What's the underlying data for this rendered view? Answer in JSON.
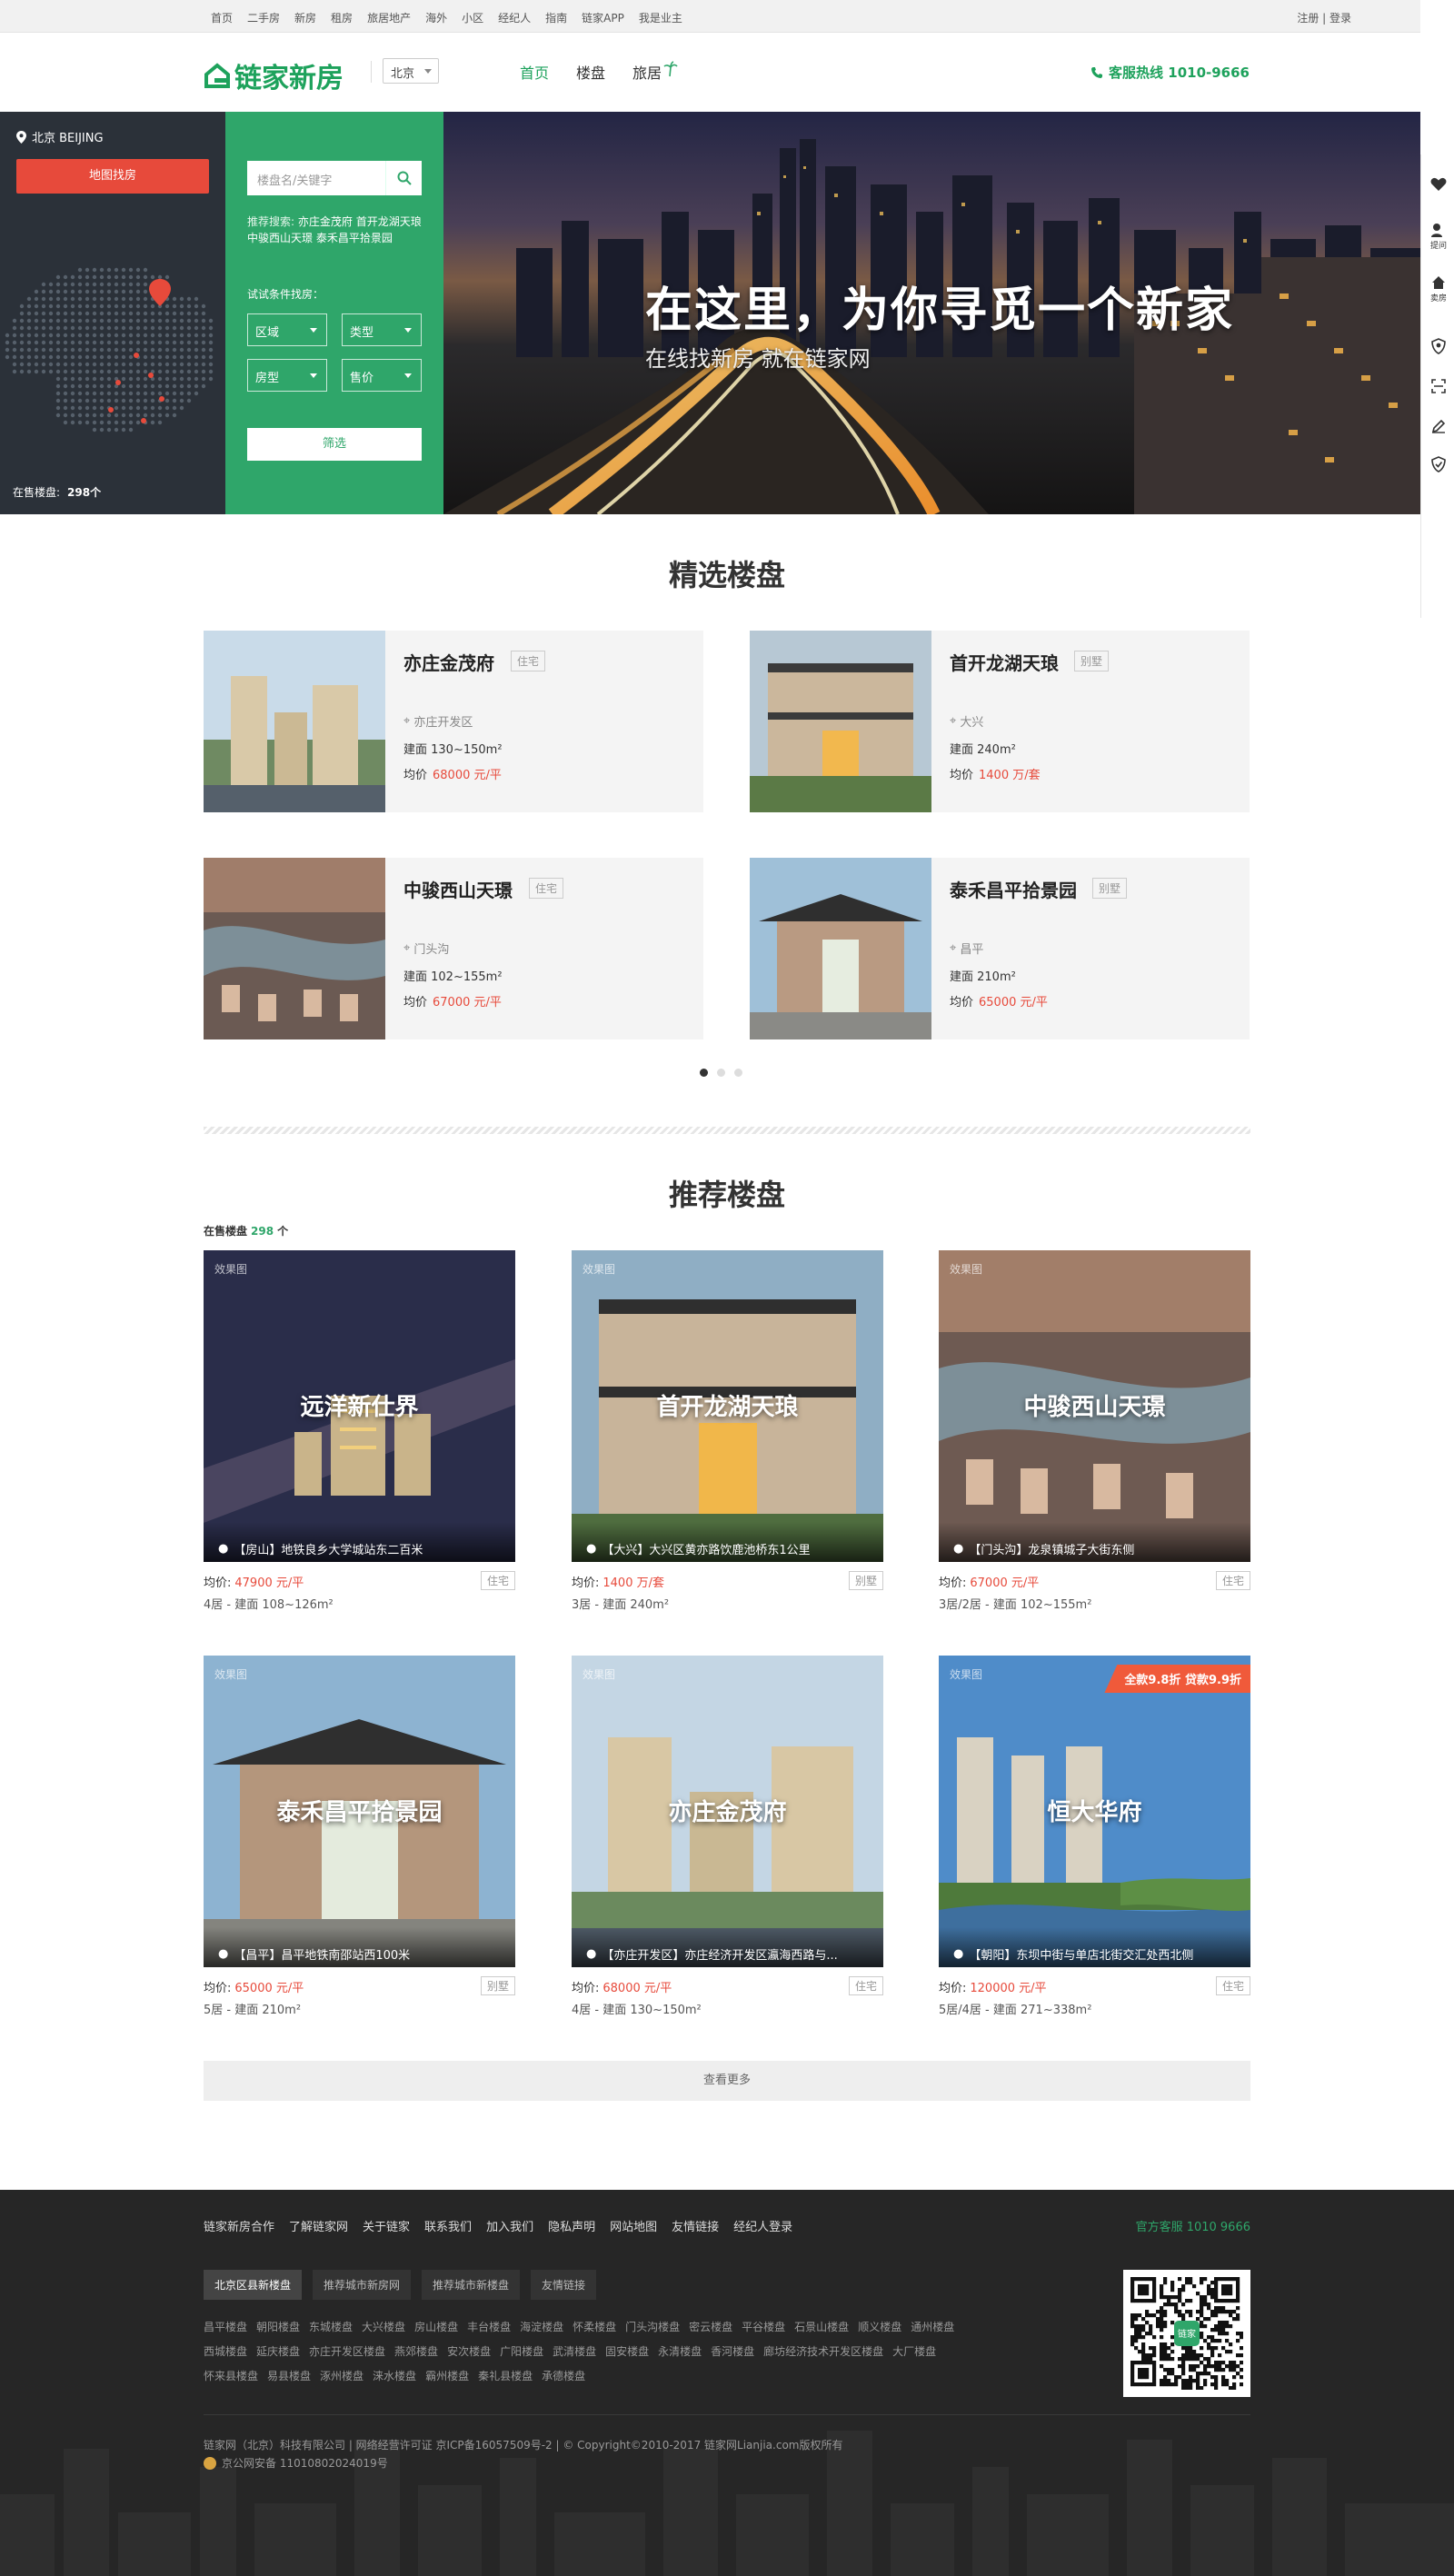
{
  "topnav": {
    "links": [
      "首页",
      "二手房",
      "新房",
      "租房",
      "旅居地产",
      "海外",
      "小区",
      "经纪人",
      "指南",
      "链家APP",
      "我是业主"
    ],
    "auth": "注册 | 登录"
  },
  "header": {
    "logo": "链家新房",
    "city": "北京",
    "menu": [
      "首页",
      "楼盘",
      "旅居"
    ],
    "hotline": "客服热线 1010-9666"
  },
  "mapbox": {
    "city": "北京 BEIJING",
    "map_button": "地图找房",
    "on_sale_label": "在售楼盘:",
    "on_sale_count": "298个"
  },
  "search": {
    "placeholder": "楼盘名/关键字",
    "recommend_label": "推荐搜索:",
    "recommend": "亦庄金茂府 首开龙湖天琅 中骏西山天璟 泰禾昌平拾景园",
    "try_label": "试试条件找房：",
    "filters": [
      "区域",
      "类型",
      "房型",
      "售价"
    ],
    "submit": "筛选"
  },
  "banner": {
    "title": "在这里，为你寻觅一个新家",
    "subtitle": "在线找新房 就在链家网"
  },
  "rightbar": {
    "labels": [
      "提问",
      "卖房"
    ]
  },
  "featured": {
    "title": "精选楼盘",
    "items": [
      {
        "name": "亦庄金茂府",
        "tag": "住宅",
        "loc": "亦庄开发区",
        "area": "建面 130~150m²",
        "price_label": "均价",
        "price": "68000 元/平"
      },
      {
        "name": "首开龙湖天琅",
        "tag": "别墅",
        "loc": "大兴",
        "area": "建面 240m²",
        "price_label": "均价",
        "price": "1400 万/套"
      },
      {
        "name": "中骏西山天璟",
        "tag": "住宅",
        "loc": "门头沟",
        "area": "建面 102~155m²",
        "price_label": "均价",
        "price": "67000 元/平"
      },
      {
        "name": "泰禾昌平拾景园",
        "tag": "别墅",
        "loc": "昌平",
        "area": "建面 210m²",
        "price_label": "均价",
        "price": "65000 元/平"
      }
    ]
  },
  "recommend": {
    "title": "推荐楼盘",
    "on_sale_prefix": "在售楼盘",
    "on_sale_count": "298",
    "on_sale_suffix": "个",
    "items": [
      {
        "label": "效果图",
        "name": "远洋新仕界",
        "addr": "【房山】地铁良乡大学城站东二百米",
        "price_label": "均价:",
        "price": "47900 元/平",
        "layout": "4居 - 建面 108~126m²",
        "tag": "住宅",
        "promo": ""
      },
      {
        "label": "效果图",
        "name": "首开龙湖天琅",
        "addr": "【大兴】大兴区黄亦路饮鹿池桥东1公里",
        "price_label": "均价:",
        "price": "1400 万/套",
        "layout": "3居 - 建面 240m²",
        "tag": "别墅",
        "promo": ""
      },
      {
        "label": "效果图",
        "name": "中骏西山天璟",
        "addr": "【门头沟】龙泉镇城子大街东侧",
        "price_label": "均价:",
        "price": "67000 元/平",
        "layout": "3居/2居 - 建面 102~155m²",
        "tag": "住宅",
        "promo": ""
      },
      {
        "label": "效果图",
        "name": "泰禾昌平拾景园",
        "addr": "【昌平】昌平地铁南邵站西100米",
        "price_label": "均价:",
        "price": "65000 元/平",
        "layout": "5居 - 建面 210m²",
        "tag": "别墅",
        "promo": ""
      },
      {
        "label": "效果图",
        "name": "亦庄金茂府",
        "addr": "【亦庄开发区】亦庄经济开发区瀛海西路与...",
        "price_label": "均价:",
        "price": "68000 元/平",
        "layout": "4居 - 建面 130~150m²",
        "tag": "住宅",
        "promo": ""
      },
      {
        "label": "效果图",
        "name": "恒大华府",
        "addr": "【朝阳】东坝中街与单店北街交汇处西北侧",
        "price_label": "均价:",
        "price": "120000 元/平",
        "layout": "5居/4居 - 建面 271~338m²",
        "tag": "住宅",
        "promo": "全款9.8折 贷款9.9折"
      }
    ],
    "more": "查看更多"
  },
  "footer": {
    "links": [
      "链家新房合作",
      "了解链家网",
      "关于链家",
      "联系我们",
      "加入我们",
      "隐私声明",
      "网站地图",
      "友情链接",
      "经纪人登录"
    ],
    "service": "官方客服 1010 9666",
    "tabs": [
      "北京区县新楼盘",
      "推荐城市新房网",
      "推荐城市新楼盘",
      "友情链接"
    ],
    "cities": [
      "昌平楼盘",
      "朝阳楼盘",
      "东城楼盘",
      "大兴楼盘",
      "房山楼盘",
      "丰台楼盘",
      "海淀楼盘",
      "怀柔楼盘",
      "门头沟楼盘",
      "密云楼盘",
      "平谷楼盘",
      "石景山楼盘",
      "顺义楼盘",
      "通州楼盘",
      "西城楼盘",
      "延庆楼盘",
      "亦庄开发区楼盘",
      "燕郊楼盘",
      "安次楼盘",
      "广阳楼盘",
      "武清楼盘",
      "固安楼盘",
      "永清楼盘",
      "香河楼盘",
      "廊坊经济技术开发区楼盘",
      "大厂楼盘",
      "怀来县楼盘",
      "易县楼盘",
      "涿州楼盘",
      "涞水楼盘",
      "霸州楼盘",
      "秦礼县楼盘",
      "承德楼盘"
    ],
    "qr_label": "链家",
    "copyright": "链家网（北京）科技有限公司 | 网络经营许可证 京ICP备16057509号-2 | © Copyright©2010-2017 链家网Lianjia.com版权所有",
    "police": "京公网安备 11010802024019号"
  },
  "colors": {
    "brand_green": "#1ea25c",
    "search_green": "#2fa66a",
    "price_red": "#e74a3b",
    "footer_bg": "#262626"
  }
}
